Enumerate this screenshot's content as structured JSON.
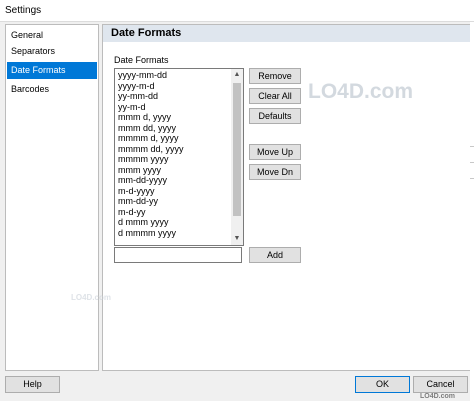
{
  "window": {
    "title": "Settings"
  },
  "sidebar": {
    "items": [
      {
        "label": "General",
        "selected": false
      },
      {
        "label": "Separators",
        "selected": false
      },
      {
        "label": "Date Formats",
        "selected": true
      },
      {
        "label": "Barcodes",
        "selected": false
      }
    ]
  },
  "panel": {
    "header": "Date Formats",
    "group_label": "Date Formats",
    "formats": [
      "yyyy-mm-dd",
      "yyyy-m-d",
      "yy-mm-dd",
      "yy-m-d",
      "mmm d, yyyy",
      "mmm dd, yyyy",
      "mmmm d, yyyy",
      "mmmm dd, yyyy",
      "mmmm yyyy",
      "mmm yyyy",
      "mm-dd-yyyy",
      "m-d-yyyy",
      "mm-dd-yy",
      "m-d-yy",
      "d mmm yyyy",
      "d mmmm yyyy"
    ],
    "new_format_value": "",
    "buttons": {
      "remove": "Remove",
      "clear_all": "Clear All",
      "defaults": "Defaults",
      "move_up": "Move Up",
      "move_dn": "Move Dn",
      "add": "Add"
    }
  },
  "footer": {
    "help": "Help",
    "ok": "OK",
    "cancel": "Cancel"
  },
  "watermark": {
    "main": "LO4D.com",
    "small": "LO4D.com",
    "bottom": "LO4D.com"
  },
  "colors": {
    "selection": "#0078d7",
    "header_bg": "#dfe6ee",
    "window_bg": "#f0f0f0"
  }
}
